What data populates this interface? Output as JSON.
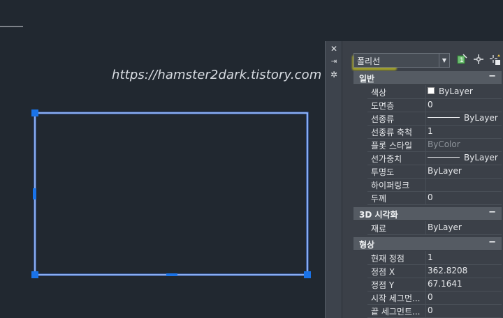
{
  "watermark": "https://hamster2dark.tistory.com",
  "palette": {
    "strip_buttons": [
      "close-icon",
      "auto-hide-icon",
      "properties-settings-icon"
    ],
    "selected_object": "폴리선",
    "toolbar_icons": [
      "toggle-pickadd-icon",
      "select-objects-icon",
      "quick-select-icon"
    ],
    "sections": [
      {
        "title": "일반",
        "toggle": "−",
        "rows": [
          {
            "name": "색상",
            "value": "ByLayer",
            "swatch": true
          },
          {
            "name": "도면층",
            "value": "0"
          },
          {
            "name": "선종류",
            "value": "ByLayer",
            "line": true
          },
          {
            "name": "선종류 축척",
            "value": "1"
          },
          {
            "name": "플롯 스타일",
            "value": "ByColor",
            "dim": true
          },
          {
            "name": "선가중치",
            "value": "ByLayer",
            "line": true
          },
          {
            "name": "투명도",
            "value": "ByLayer"
          },
          {
            "name": "하이퍼링크",
            "value": ""
          },
          {
            "name": "두께",
            "value": "0"
          }
        ]
      },
      {
        "title": "3D 시각화",
        "toggle": "−",
        "rows": [
          {
            "name": "재료",
            "value": "ByLayer"
          }
        ]
      },
      {
        "title": "형상",
        "toggle": "−",
        "rows": [
          {
            "name": "현재 정점",
            "value": "1"
          },
          {
            "name": "정점 X",
            "value": "362.8208"
          },
          {
            "name": "정점 Y",
            "value": "67.1641"
          },
          {
            "name": "시작 세그먼...",
            "value": "0"
          },
          {
            "name": "끝 세그먼트...",
            "value": "0"
          }
        ]
      }
    ]
  },
  "colors": {
    "canvas_bg": "#212830",
    "grip": "#1a73e8",
    "selection_highlight": "#8ab0ff",
    "palette_bg": "#3b4048",
    "section_bg": "#555b63"
  }
}
